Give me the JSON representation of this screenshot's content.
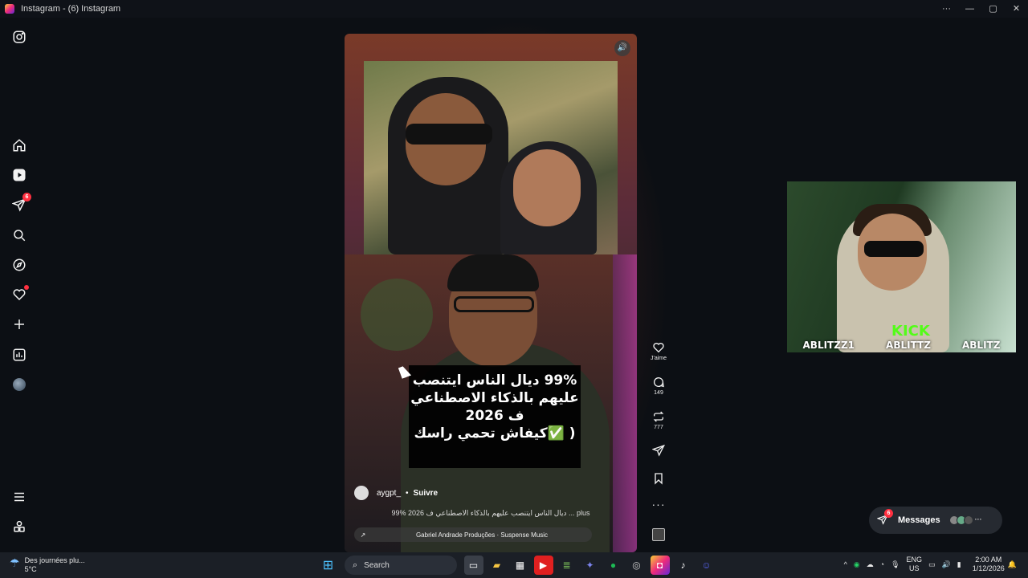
{
  "window": {
    "title": "Instagram - (6) Instagram",
    "controls": [
      "···",
      "—",
      "▢",
      "✕"
    ]
  },
  "sidebar": {
    "items": [
      {
        "name": "instagram-logo-icon"
      },
      {
        "name": "home-icon"
      },
      {
        "name": "reels-icon"
      },
      {
        "name": "direct-messages-icon",
        "badge": "6"
      },
      {
        "name": "search-icon"
      },
      {
        "name": "explore-icon"
      },
      {
        "name": "notifications-icon"
      },
      {
        "name": "create-icon"
      },
      {
        "name": "dashboard-icon"
      },
      {
        "name": "profile-avatar"
      },
      {
        "name": "menu-icon"
      },
      {
        "name": "also-from-meta-icon"
      }
    ]
  },
  "reel": {
    "caption_lines": [
      "99% ديال الناس ايتنصب",
      "عليهم بالذكاء الاصطناعي",
      "ف 2026",
      "( ✅كيفاش تحمي راسك"
    ],
    "author": "aygpt_",
    "separator": "•",
    "follow_label": "Suivre",
    "description": "99% ديال الناس ايتنصب عليهم بالذكاء الاصطناعي ف 2026 ... plus",
    "music": "Gabriel Andrade Produções · Suspense Music",
    "music_arrow": "↗",
    "sound_icon": "🔊"
  },
  "actions": {
    "like_label": "J'aime",
    "comments_count": "149",
    "reposts_count": "777",
    "more": "···"
  },
  "webcam": {
    "handles": [
      "ABLITZZ1",
      "ABLITTZ",
      "ABLITZ"
    ],
    "kick_logo": "KICK"
  },
  "messages": {
    "label": "Messages",
    "badge": "6",
    "more": "···"
  },
  "taskbar": {
    "weather_line1": "Des journées plu...",
    "weather_line2": "5°C",
    "search_placeholder": "Search",
    "lang_line1": "ENG",
    "lang_line2": "US",
    "time": "2:00 AM",
    "date": "1/12/2026",
    "tray_up": "^"
  }
}
